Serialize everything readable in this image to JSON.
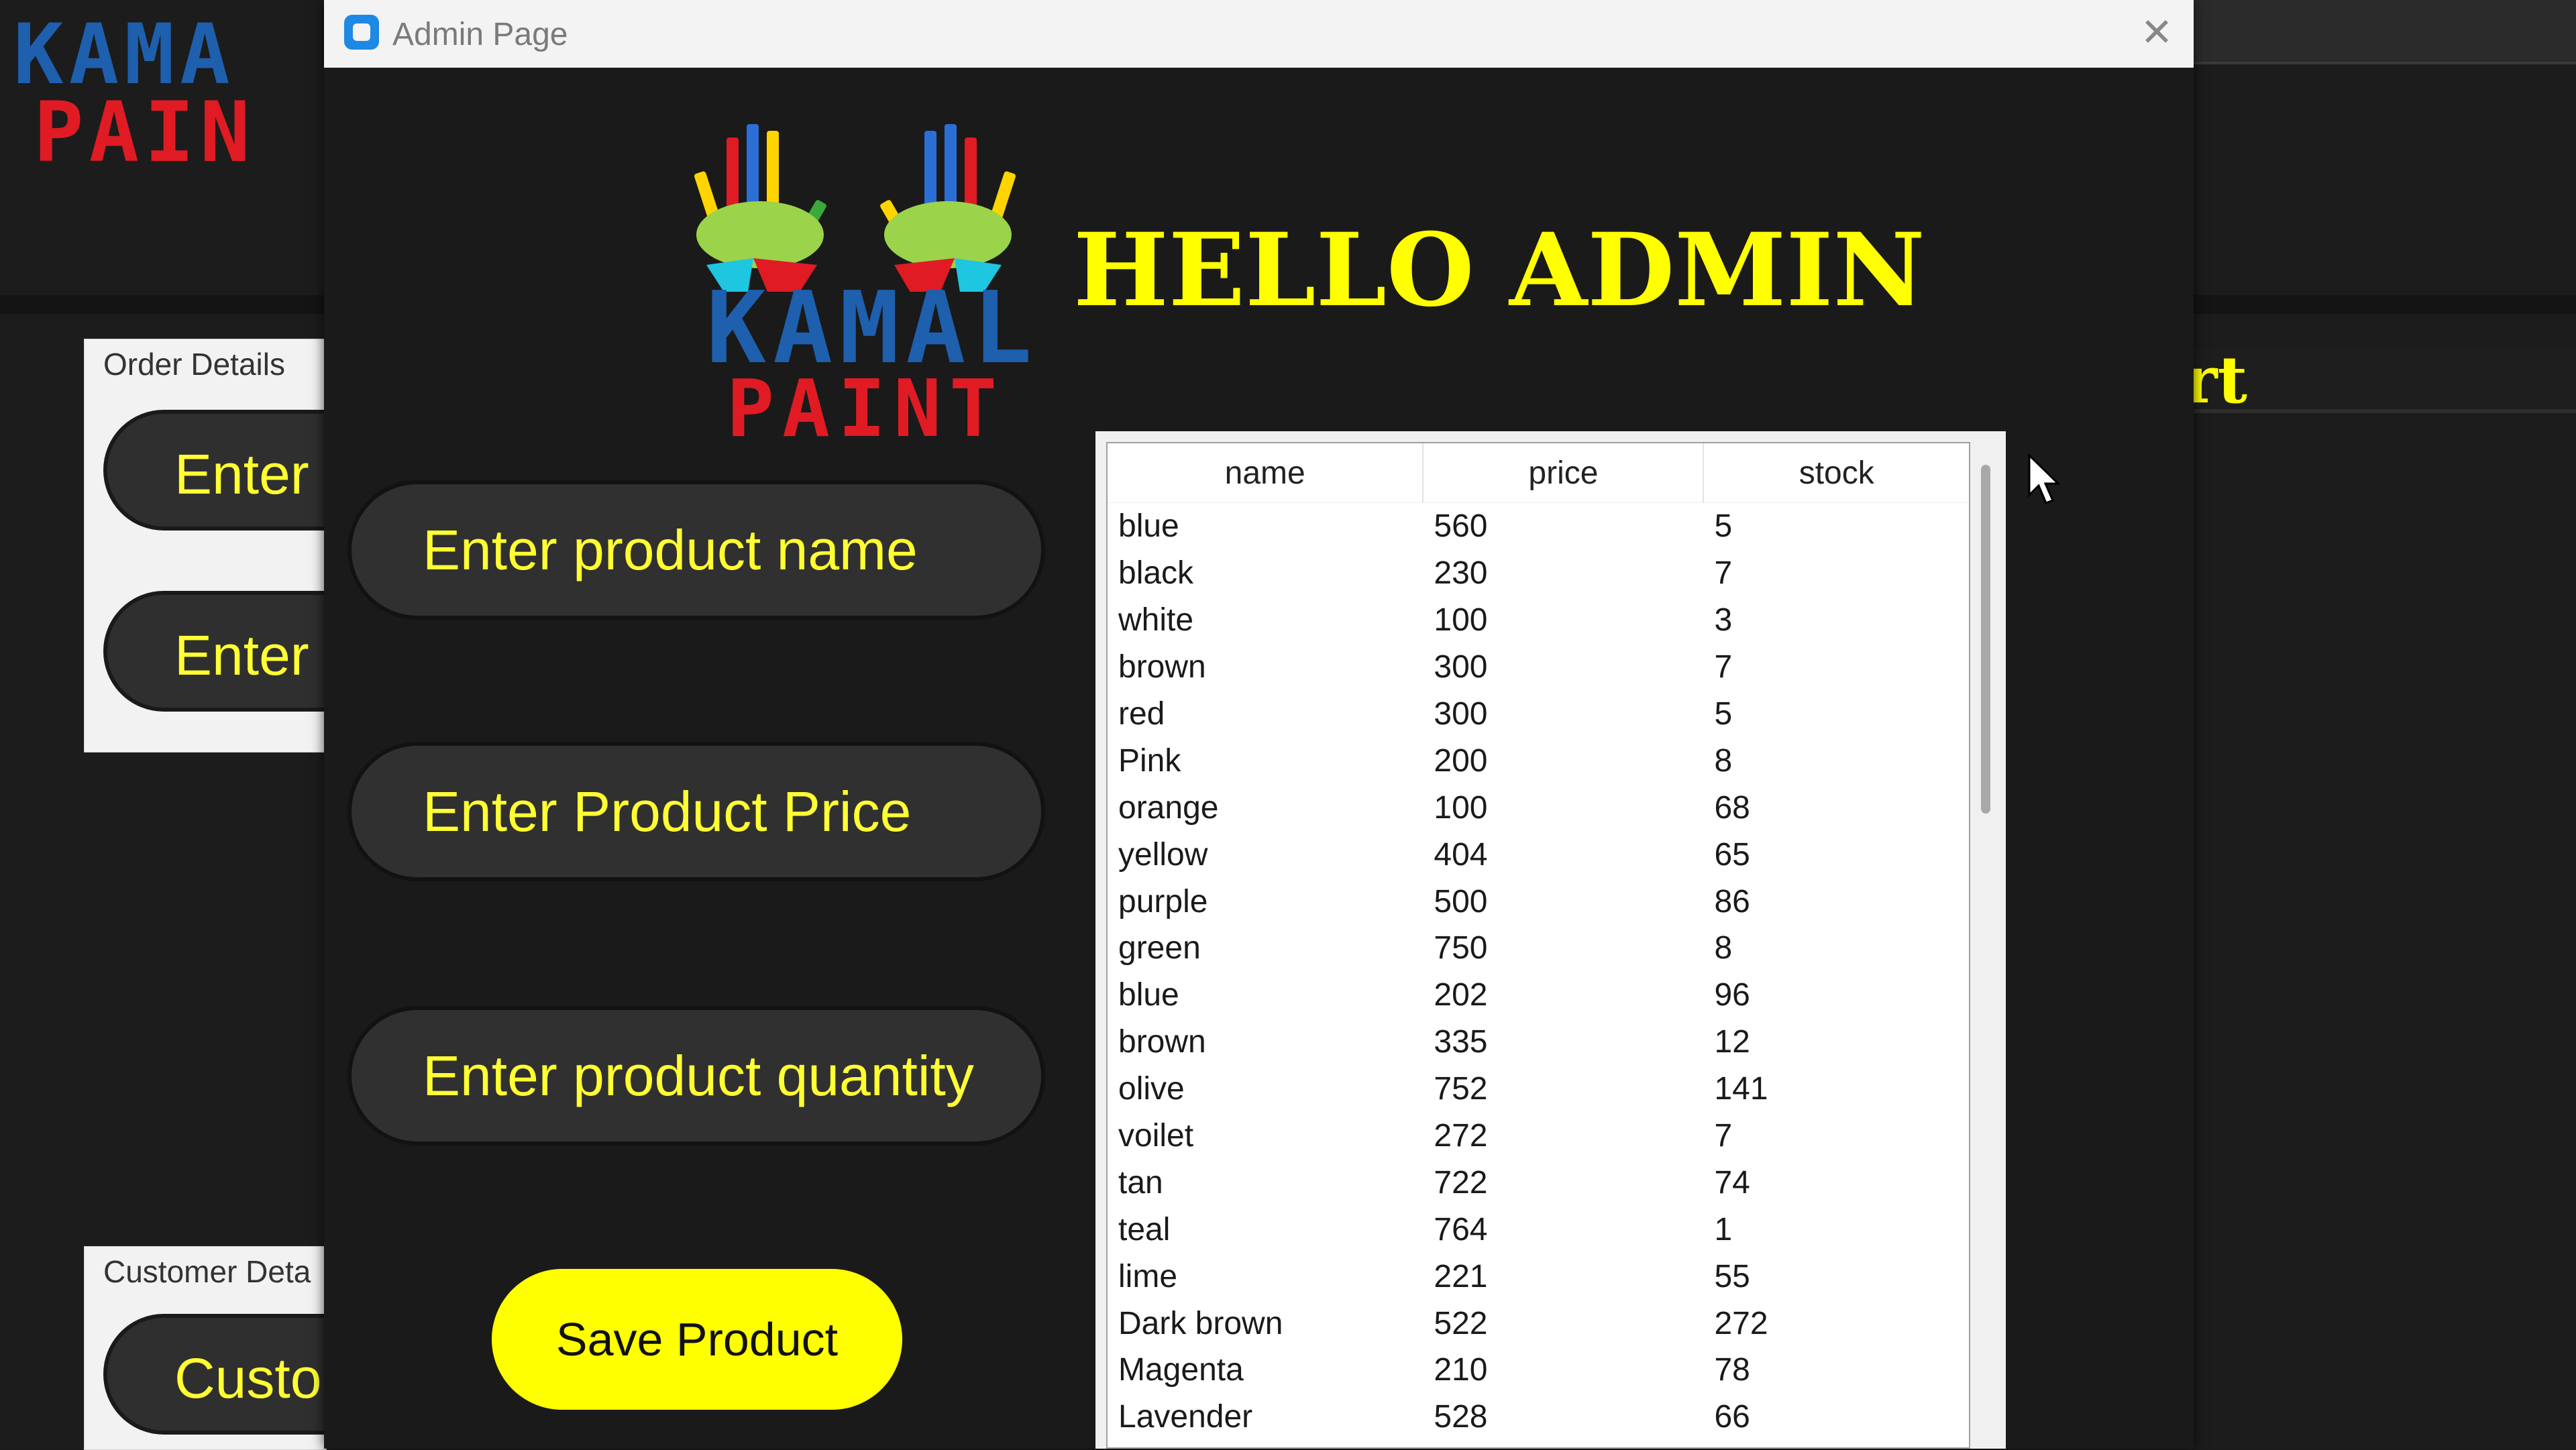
{
  "background_window": {
    "logo_text_top": "KAMA",
    "logo_text_bottom": "PAIN",
    "right_title_fragment": "rt",
    "order_panel": {
      "caption": "Order Details",
      "fields": [
        "Enter",
        "Enter"
      ]
    },
    "customer_panel": {
      "caption": "Customer Deta",
      "field": "Custo"
    }
  },
  "admin_dialog": {
    "title": "Admin Page",
    "close_icon": "close-icon",
    "logo": {
      "text_top": "KAMAL",
      "text_bottom": "PAINT"
    },
    "heading": "HELLO ADMIN",
    "inputs": {
      "name_placeholder": "Enter product name",
      "price_placeholder": "Enter Product Price",
      "quantity_placeholder": "Enter product quantity"
    },
    "save_label": "Save Product",
    "table": {
      "columns": [
        "name",
        "price",
        "stock"
      ],
      "rows": [
        [
          "blue",
          "560",
          "5"
        ],
        [
          "black",
          "230",
          "7"
        ],
        [
          "white",
          "100",
          "3"
        ],
        [
          "brown",
          "300",
          "7"
        ],
        [
          "red",
          "300",
          "5"
        ],
        [
          "Pink",
          "200",
          "8"
        ],
        [
          "orange",
          "100",
          "68"
        ],
        [
          "yellow",
          "404",
          "65"
        ],
        [
          "purple",
          "500",
          "86"
        ],
        [
          "green",
          "750",
          "8"
        ],
        [
          "blue",
          "202",
          "96"
        ],
        [
          "brown",
          "335",
          "12"
        ],
        [
          "olive",
          "752",
          "141"
        ],
        [
          "voilet",
          "272",
          "7"
        ],
        [
          "tan",
          "722",
          "74"
        ],
        [
          "teal",
          "764",
          "1"
        ],
        [
          "lime",
          "221",
          "55"
        ],
        [
          "Dark brown",
          "522",
          "272"
        ],
        [
          "Magenta",
          "210",
          "78"
        ],
        [
          "Lavender",
          "528",
          "66"
        ]
      ]
    }
  },
  "colors": {
    "accent": "#ffff00",
    "field_bg": "#303030",
    "dialog_bg": "#1a1a1a",
    "logo_blue": "#1e5fae",
    "logo_red": "#e01b24"
  }
}
